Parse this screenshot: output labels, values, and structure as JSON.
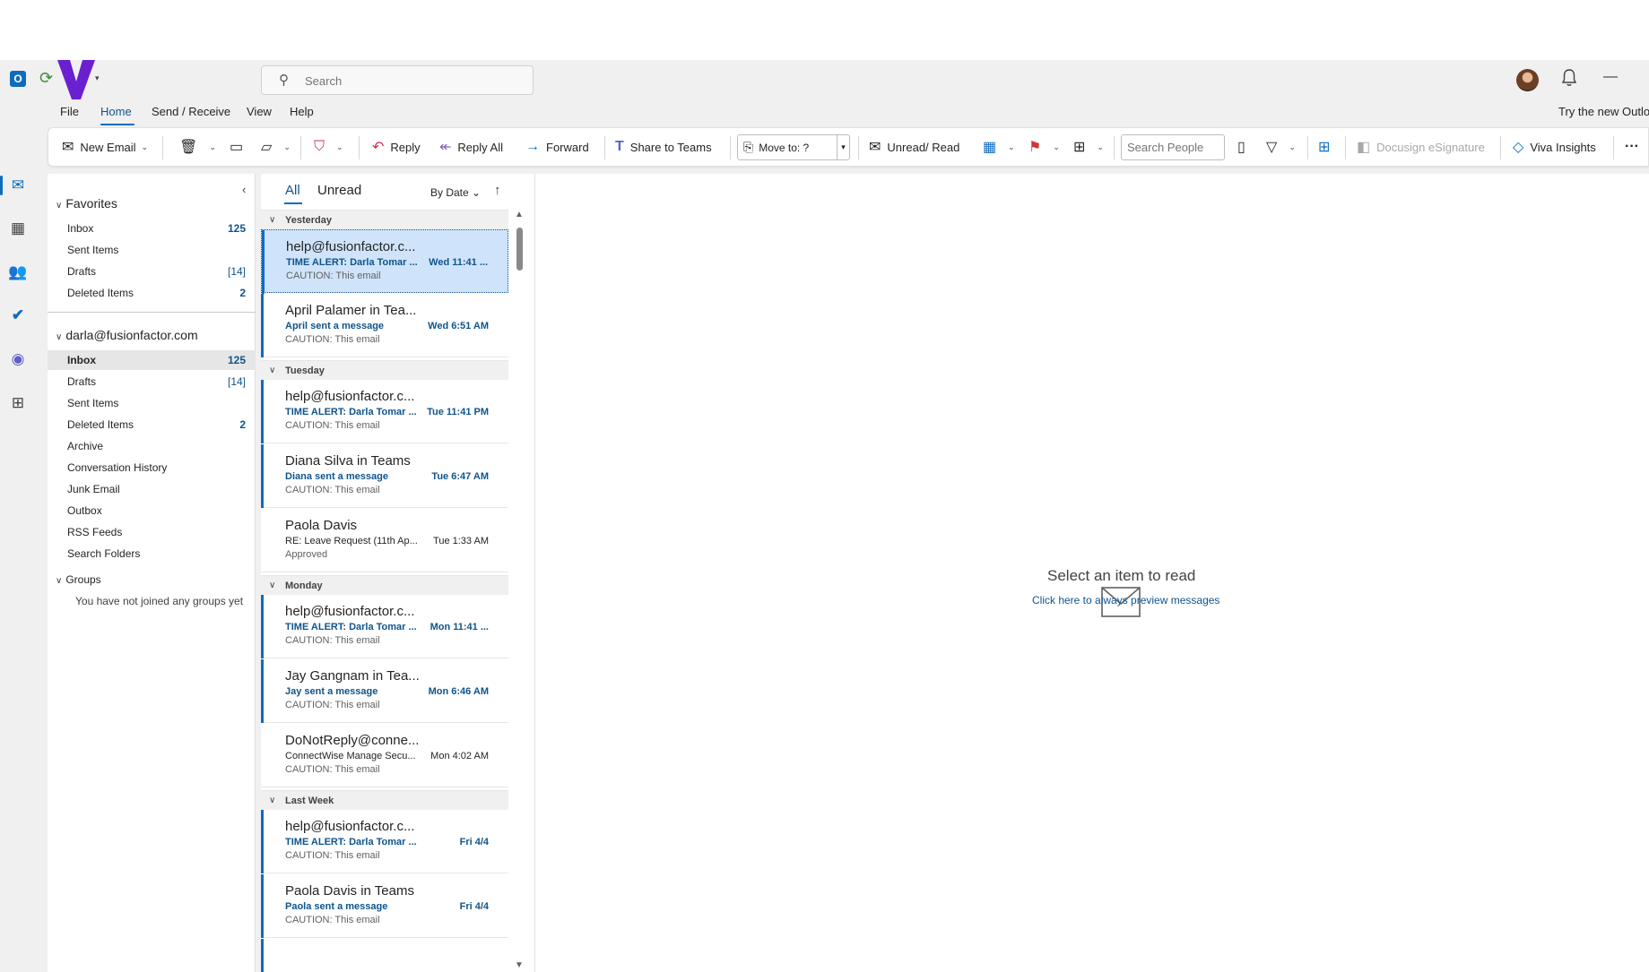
{
  "titlebar": {
    "search_placeholder": "Search",
    "outlook_glyph": "O",
    "icons": [
      "outlook-icon",
      "sync-icon",
      "v-logo",
      "search-icon",
      "avatar",
      "bell-icon",
      "minimize-icon"
    ]
  },
  "menu": {
    "items": [
      "File",
      "Home",
      "Send / Receive",
      "View",
      "Help"
    ],
    "try_new": "Try the new Outlo"
  },
  "ribbon": {
    "new_email": "New Email",
    "reply": "Reply",
    "reply_all": "Reply All",
    "forward": "Forward",
    "share_teams": "Share to Teams",
    "move_to": "Move to: ?",
    "unread_read": "Unread/ Read",
    "search_people_placeholder": "Search People",
    "docusign": "Docusign eSignature",
    "viva": "Viva Insights",
    "more": "···"
  },
  "folders": {
    "favorites_label": "Favorites",
    "favorites": [
      {
        "name": "Inbox",
        "count": "125"
      },
      {
        "name": "Sent Items",
        "count": ""
      },
      {
        "name": "Drafts",
        "count": "[14]"
      },
      {
        "name": "Deleted Items",
        "count": "2"
      }
    ],
    "account_label": "darla@fusionfactor.com",
    "account": [
      {
        "name": "Inbox",
        "count": "125"
      },
      {
        "name": "Drafts",
        "count": "[14]"
      },
      {
        "name": "Sent Items",
        "count": ""
      },
      {
        "name": "Deleted Items",
        "count": "2"
      },
      {
        "name": "Archive",
        "count": ""
      },
      {
        "name": "Conversation History",
        "count": ""
      },
      {
        "name": "Junk Email",
        "count": ""
      },
      {
        "name": "Outbox",
        "count": ""
      },
      {
        "name": "RSS Feeds",
        "count": ""
      },
      {
        "name": "Search Folders",
        "count": ""
      }
    ],
    "groups_label": "Groups",
    "groups_empty": "You have not joined any groups yet"
  },
  "list": {
    "tab_all": "All",
    "tab_unread": "Unread",
    "sort_label": "By Date",
    "groups": [
      "Yesterday",
      "Tuesday",
      "Monday",
      "Last Week"
    ],
    "messages": [
      {
        "from": "help@fusionfactor.c...",
        "subject": "TIME ALERT: Darla Tomar ...",
        "time": "Wed 11:41 ...",
        "preview": "CAUTION: This email"
      },
      {
        "from": "April Palamer in Tea...",
        "subject": "April sent a message",
        "time": "Wed 6:51 AM",
        "preview": "CAUTION: This email"
      },
      {
        "from": "help@fusionfactor.c...",
        "subject": "TIME ALERT: Darla Tomar ...",
        "time": "Tue 11:41 PM",
        "preview": "CAUTION: This email"
      },
      {
        "from": "Diana Silva in Teams",
        "subject": "Diana sent a message",
        "time": "Tue 6:47 AM",
        "preview": "CAUTION: This email"
      },
      {
        "from": "Paola Davis",
        "subject": "RE: Leave Request (11th Ap...",
        "time": "Tue 1:33 AM",
        "preview": "Approved"
      },
      {
        "from": "help@fusionfactor.c...",
        "subject": "TIME ALERT: Darla Tomar ...",
        "time": "Mon 11:41 ...",
        "preview": "CAUTION: This email"
      },
      {
        "from": "Jay Gangnam in Tea...",
        "subject": "Jay sent a message",
        "time": "Mon 6:46 AM",
        "preview": "CAUTION: This email"
      },
      {
        "from": "DoNotReply@conne...",
        "subject": "ConnectWise Manage Secu...",
        "time": "Mon 4:02 AM",
        "preview": "CAUTION: This email"
      },
      {
        "from": "help@fusionfactor.c...",
        "subject": "TIME ALERT: Darla Tomar ...",
        "time": "Fri 4/4",
        "preview": "CAUTION: This email"
      },
      {
        "from": "Paola Davis in Teams",
        "subject": "Paola sent a message",
        "time": "Fri 4/4",
        "preview": "CAUTION: This email"
      }
    ]
  },
  "reading": {
    "select_text": "Select an item to read",
    "preview_link": "Click here to always preview messages"
  },
  "colors": {
    "accent": "#0f6cbd",
    "accent_text": "#0f548c",
    "selected_bg": "#cfe4fa",
    "v_logo": "#6a1fd1"
  }
}
